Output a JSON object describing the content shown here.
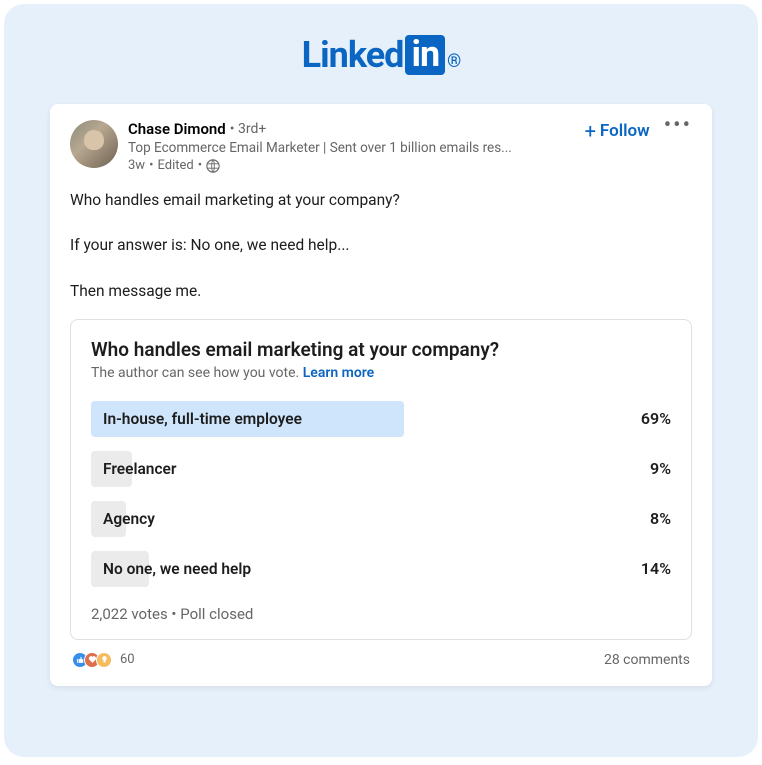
{
  "logo": {
    "text_left": "Linked",
    "text_in": "in"
  },
  "post": {
    "author": {
      "name": "Chase Dimond",
      "degree": "• 3rd+",
      "tagline": "Top Ecommerce Email Marketer | Sent over 1 billion emails res...",
      "time": "3w",
      "edited": "Edited"
    },
    "follow_label": "Follow",
    "body": {
      "p1": "Who handles email marketing at your company?",
      "p2": "If your answer is: No one, we need help...",
      "p3": "Then message me."
    }
  },
  "poll": {
    "title": "Who handles email marketing at your company?",
    "note": "The author can see how you vote.",
    "learn_more": "Learn more",
    "options": [
      {
        "label": "In-house, full-time employee",
        "pct": "69%",
        "width": 54,
        "top": true
      },
      {
        "label": "Freelancer",
        "pct": "9%",
        "width": 7,
        "top": false
      },
      {
        "label": "Agency",
        "pct": "8%",
        "width": 6,
        "top": false
      },
      {
        "label": "No one, we need help",
        "pct": "14%",
        "width": 10,
        "top": false
      }
    ],
    "footer": "2,022 votes • Poll closed"
  },
  "social": {
    "like_count": "60",
    "comments": "28 comments"
  },
  "chart_data": {
    "type": "bar",
    "title": "Who handles email marketing at your company?",
    "categories": [
      "In-house, full-time employee",
      "Freelancer",
      "Agency",
      "No one, we need help"
    ],
    "values": [
      69,
      9,
      8,
      14
    ],
    "unit": "%",
    "total_votes": 2022,
    "status": "Poll closed"
  }
}
